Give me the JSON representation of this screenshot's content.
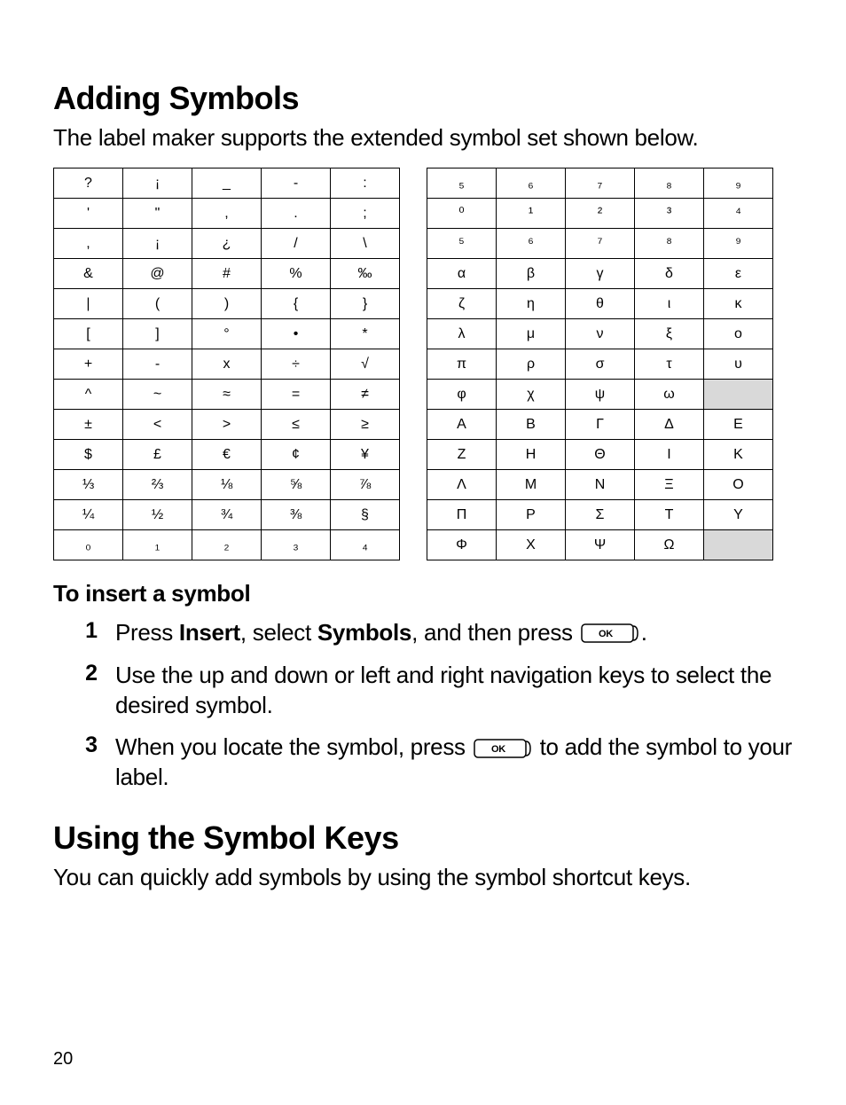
{
  "page_number": "20",
  "heading1": "Adding Symbols",
  "intro1": "The label maker supports the extended symbol set shown below.",
  "left_table": [
    [
      "?",
      "¡",
      "_",
      "-",
      ":"
    ],
    [
      "'",
      "\"",
      ",",
      ".",
      ";"
    ],
    [
      ",",
      "¡",
      "¿",
      "/",
      "\\"
    ],
    [
      "&",
      "@",
      "#",
      "%",
      "‰"
    ],
    [
      "|",
      "(",
      ")",
      "{",
      "}"
    ],
    [
      "[",
      "]",
      "°",
      "•",
      "*"
    ],
    [
      "+",
      "-",
      "x",
      "÷",
      "√"
    ],
    [
      "^",
      "~",
      "≈",
      "=",
      "≠"
    ],
    [
      "±",
      "<",
      ">",
      "≤",
      "≥"
    ],
    [
      "$",
      "£",
      "€",
      "¢",
      "¥"
    ],
    [
      "⅓",
      "⅔",
      "⅛",
      "⅝",
      "⅞"
    ],
    [
      "¼",
      "½",
      "¾",
      "⅜",
      "§"
    ],
    [
      "₀",
      "₁",
      "₂",
      "₃",
      "₄"
    ]
  ],
  "right_table": [
    [
      "₅",
      "₆",
      "₇",
      "₈",
      "₉"
    ],
    [
      "⁰",
      "¹",
      "²",
      "³",
      "⁴"
    ],
    [
      "⁵",
      "⁶",
      "⁷",
      "⁸",
      "⁹"
    ],
    [
      "α",
      "β",
      "γ",
      "δ",
      "ε"
    ],
    [
      "ζ",
      "η",
      "θ",
      "ι",
      "κ"
    ],
    [
      "λ",
      "μ",
      "ν",
      "ξ",
      "ο"
    ],
    [
      "π",
      "ρ",
      "σ",
      "τ",
      "υ"
    ],
    [
      "φ",
      "χ",
      "ψ",
      "ω",
      ""
    ],
    [
      "Α",
      "Β",
      "Γ",
      "Δ",
      "Ε"
    ],
    [
      "Ζ",
      "Η",
      "Θ",
      "Ι",
      "Κ"
    ],
    [
      "Λ",
      "Μ",
      "Ν",
      "Ξ",
      "Ο"
    ],
    [
      "Π",
      "Ρ",
      "Σ",
      "Τ",
      "Υ"
    ],
    [
      "Φ",
      "Χ",
      "Ψ",
      "Ω",
      ""
    ]
  ],
  "right_shaded": [
    [
      7,
      4
    ],
    [
      12,
      4
    ]
  ],
  "subhead1": "To insert a symbol",
  "steps": {
    "1": {
      "num": "1",
      "pre": "Press ",
      "b1": "Insert",
      "mid": ", select ",
      "b2": "Symbols",
      "post1": ", and then press ",
      "post2": "."
    },
    "2": {
      "num": "2",
      "text": "Use the up and down or left and right navigation keys to select the desired symbol."
    },
    "3": {
      "num": "3",
      "pre": "When you locate the symbol, press ",
      "post": " to add the symbol to your label."
    }
  },
  "heading2": "Using the Symbol Keys",
  "intro2": "You can quickly add symbols by using the symbol shortcut keys.",
  "ok_label": "OK"
}
